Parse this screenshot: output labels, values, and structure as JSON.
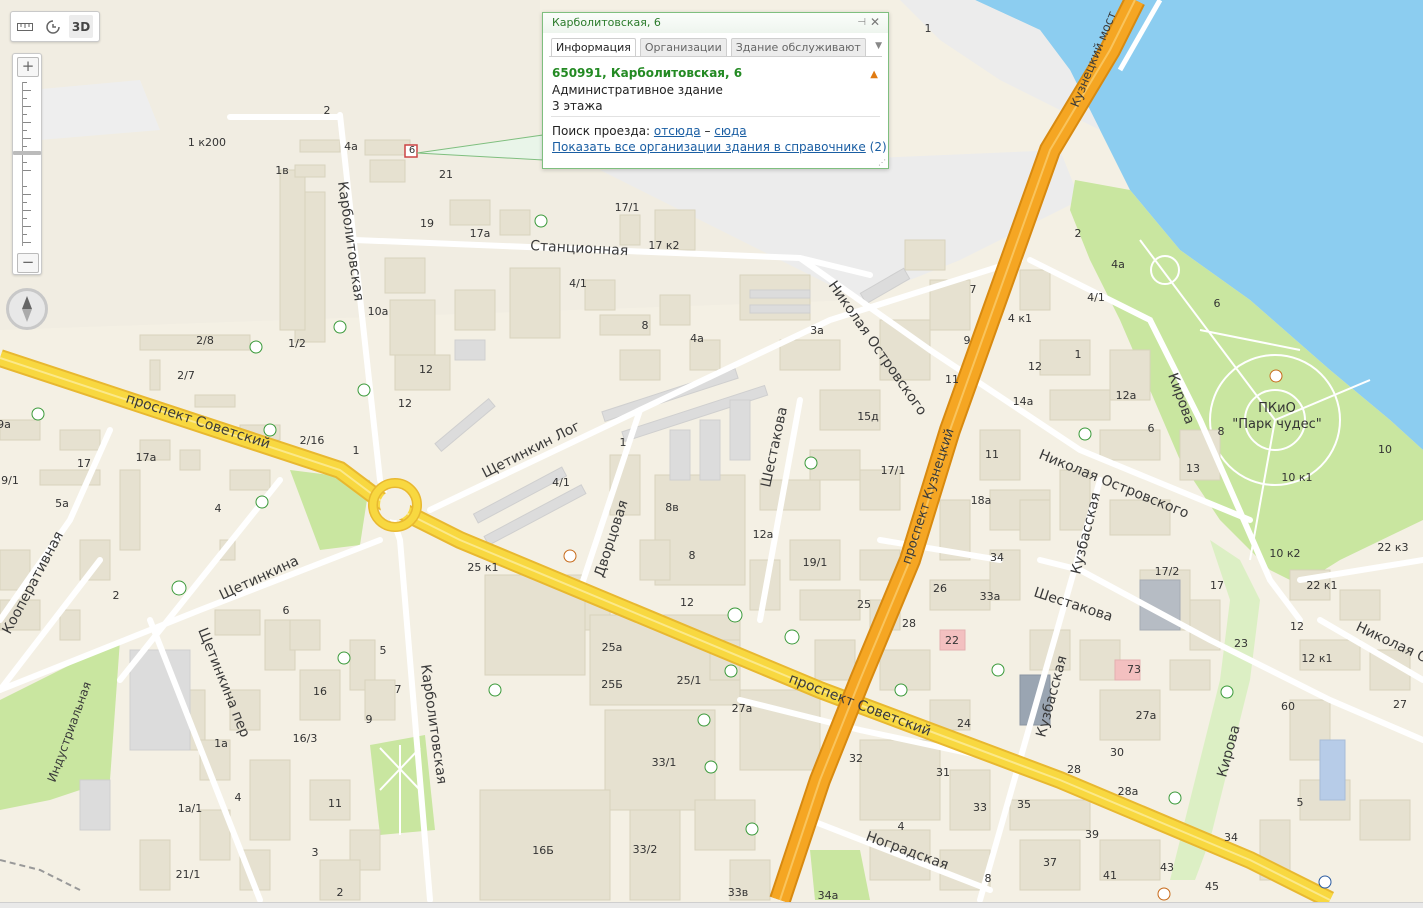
{
  "toolbar": {
    "ruler_icon": "ruler-icon",
    "history_icon": "history-icon",
    "mode_label": "3D"
  },
  "zoom": {
    "plus": "+",
    "minus": "−",
    "level_fraction": 0.42
  },
  "popup": {
    "header_title": "Карболитовская, 6",
    "tabs": [
      "Информация",
      "Организации",
      "Здание обслуживают"
    ],
    "active_tab": "Информация",
    "address": "650991, Карболитовская, 6",
    "building_type": "Административное здание",
    "floors": "3 этажа",
    "route_label": "Поиск проезда:",
    "route_from": "отсюда",
    "route_dash": "–",
    "route_to": "сюда",
    "show_all_link": "Показать все организации здания в справочнике",
    "show_all_count": "(2)"
  },
  "map": {
    "colors": {
      "background": "#f4f0e4",
      "building": "#e6e1d0",
      "building_edge": "#d6d0bc",
      "park": "#c9e6a0",
      "water": "#8ccdf0",
      "major_road": "#f8d840",
      "highway": "#f5a623",
      "minor_road": "#ffffff"
    },
    "streets": [
      "проспект Советский",
      "проспект Советский",
      "Карболитовская",
      "Карболитовская",
      "Станционная",
      "Николая Островского",
      "Николая Островского",
      "Николая Островского",
      "Кузнецкий мост",
      "проспект Кузнецкий",
      "Щетинкин Лог",
      "Дворцовая",
      "Шестакова",
      "Шестакова",
      "Щетинкина",
      "Щетинкина пер",
      "Кооперативная",
      "Индустриальная",
      "Кузбасская",
      "Кузбасская",
      "Кирова",
      "Кирова",
      "Ноградская"
    ],
    "park_name": "ПКиО\n\"Парк чудес\"",
    "park_line1": "ПКиО",
    "park_line2": "\"Парк чудес\"",
    "house_numbers": [
      "2",
      "1 к200",
      "4а",
      "6",
      "1в",
      "21",
      "19",
      "17/1",
      "17а",
      "17 к2",
      "4/1",
      "10а",
      "12",
      "12",
      "2/8",
      "1/2",
      "2/7",
      "2/16",
      "1",
      "8",
      "4а",
      "3а",
      "15д",
      "17/1",
      "1",
      "4/1",
      "8в",
      "8",
      "12а",
      "19/1",
      "25",
      "25 к1",
      "12",
      "25а",
      "25Б",
      "25/1",
      "27а",
      "33/1",
      "33/2",
      "16Б",
      "33в",
      "34а",
      "9а",
      "17",
      "17а",
      "5а",
      "9/1",
      "4",
      "2",
      "6",
      "5",
      "16",
      "9",
      "7",
      "1а",
      "16/3",
      "4",
      "1а/1",
      "11",
      "3",
      "21/1",
      "2",
      "7",
      "4 к1",
      "9",
      "11",
      "1",
      "12",
      "14а",
      "12а",
      "6",
      "4/1",
      "4а",
      "2",
      "11",
      "18а",
      "34",
      "26",
      "33а",
      "28",
      "22",
      "73",
      "27а",
      "30",
      "28",
      "28а",
      "24",
      "32",
      "31",
      "33",
      "4",
      "35",
      "39",
      "37",
      "41",
      "43",
      "45",
      "8",
      "13",
      "17/2",
      "17",
      "23",
      "12",
      "12 к1",
      "60",
      "5",
      "34",
      "22 к1",
      "22 к3",
      "10 к1",
      "10 к2",
      "10",
      "8",
      "6",
      "27",
      "1"
    ]
  }
}
